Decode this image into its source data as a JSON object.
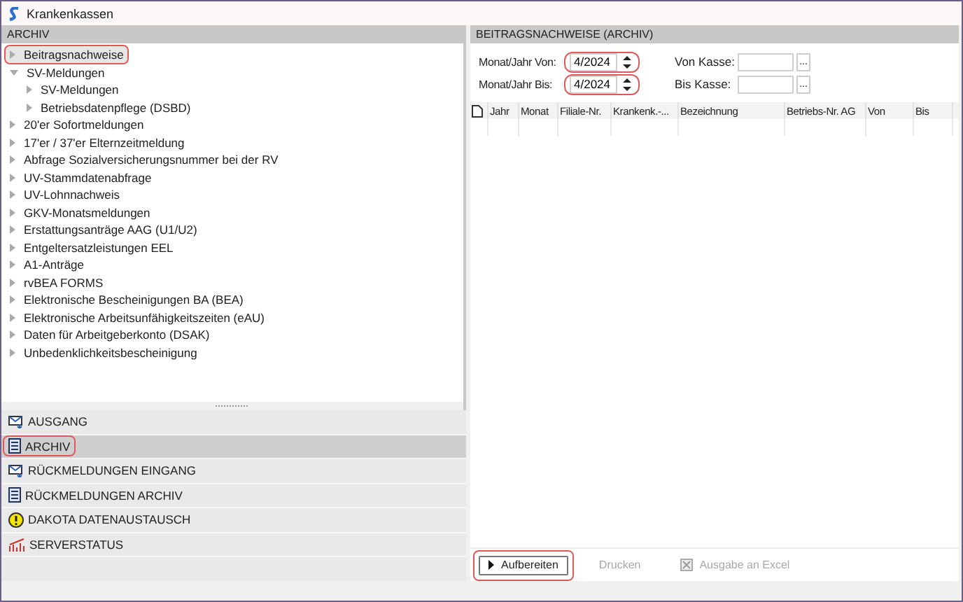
{
  "window": {
    "title": "Krankenkassen"
  },
  "left_panel": {
    "title": "ARCHIV",
    "tree": [
      {
        "label": "Beitragsnachweise",
        "selected": true,
        "highlighted": true,
        "expanded": false
      },
      {
        "label": "SV-Meldungen",
        "selected": false,
        "highlighted": false,
        "expanded": true,
        "children": [
          {
            "label": "SV-Meldungen",
            "selected": false,
            "highlighted": false,
            "expanded": false
          },
          {
            "label": "Betriebsdatenpflege (DSBD)",
            "selected": false,
            "highlighted": false,
            "expanded": false
          }
        ]
      },
      {
        "label": "20'er Sofortmeldungen",
        "selected": false,
        "highlighted": false,
        "expanded": false
      },
      {
        "label": "17'er / 37'er Elternzeitmeldung",
        "selected": false,
        "highlighted": false,
        "expanded": false
      },
      {
        "label": "Abfrage Sozialversicherungsnummer bei der RV",
        "selected": false,
        "highlighted": false,
        "expanded": false
      },
      {
        "label": "UV-Stammdatenabfrage",
        "selected": false,
        "highlighted": false,
        "expanded": false
      },
      {
        "label": "UV-Lohnnachweis",
        "selected": false,
        "highlighted": false,
        "expanded": false
      },
      {
        "label": "GKV-Monatsmeldungen",
        "selected": false,
        "highlighted": false,
        "expanded": false
      },
      {
        "label": "Erstattungsanträge AAG (U1/U2)",
        "selected": false,
        "highlighted": false,
        "expanded": false
      },
      {
        "label": "Entgeltersatzleistungen EEL",
        "selected": false,
        "highlighted": false,
        "expanded": false
      },
      {
        "label": "A1-Anträge",
        "selected": false,
        "highlighted": false,
        "expanded": false
      },
      {
        "label": "rvBEA FORMS",
        "selected": false,
        "highlighted": false,
        "expanded": false
      },
      {
        "label": "Elektronische Bescheinigungen BA (BEA)",
        "selected": false,
        "highlighted": false,
        "expanded": false
      },
      {
        "label": "Elektronische Arbeitsunfähigkeitszeiten (eAU)",
        "selected": false,
        "highlighted": false,
        "expanded": false
      },
      {
        "label": "Daten für Arbeitgeberkonto (DSAK)",
        "selected": false,
        "highlighted": false,
        "expanded": false
      },
      {
        "label": "Unbedenklichkeitsbescheinigung",
        "selected": false,
        "highlighted": false,
        "expanded": false
      }
    ],
    "nav": [
      {
        "label": "AUSGANG",
        "selected": false,
        "highlighted": false
      },
      {
        "label": "ARCHIV",
        "selected": true,
        "highlighted": true
      },
      {
        "label": "RÜCKMELDUNGEN EINGANG",
        "selected": false,
        "highlighted": false
      },
      {
        "label": "RÜCKMELDUNGEN ARCHIV",
        "selected": false,
        "highlighted": false
      },
      {
        "label": "DAKOTA DATENAUSTAUSCH",
        "selected": false,
        "highlighted": false
      },
      {
        "label": "SERVERSTATUS",
        "selected": false,
        "highlighted": false
      }
    ]
  },
  "right_panel": {
    "title": "BEITRAGSNACHWEISE (ARCHIV)",
    "date_fields": {
      "highlighted": true,
      "items": [
        {
          "label": "Monat/Jahr Von:",
          "value": "4/2024"
        },
        {
          "label": "Monat/Jahr Bis:",
          "value": "4/2024"
        }
      ]
    },
    "kasse_fields": [
      {
        "label": "Von Kasse:",
        "button": "..."
      },
      {
        "label": "Bis Kasse:",
        "button": "..."
      }
    ],
    "table": {
      "columns": [
        "Jahr",
        "Monat",
        "Filiale-Nr.",
        "Krankenk.-...",
        "Bezeichnung",
        "Betriebs-Nr. AG",
        "Von",
        "Bis"
      ]
    },
    "buttons": [
      {
        "label": "Aufbereiten",
        "disabled": false,
        "highlighted": true
      },
      {
        "label": "Drucken",
        "disabled": true,
        "highlighted": false
      },
      {
        "label": "Ausgabe an Excel",
        "disabled": true,
        "highlighted": false
      }
    ]
  }
}
